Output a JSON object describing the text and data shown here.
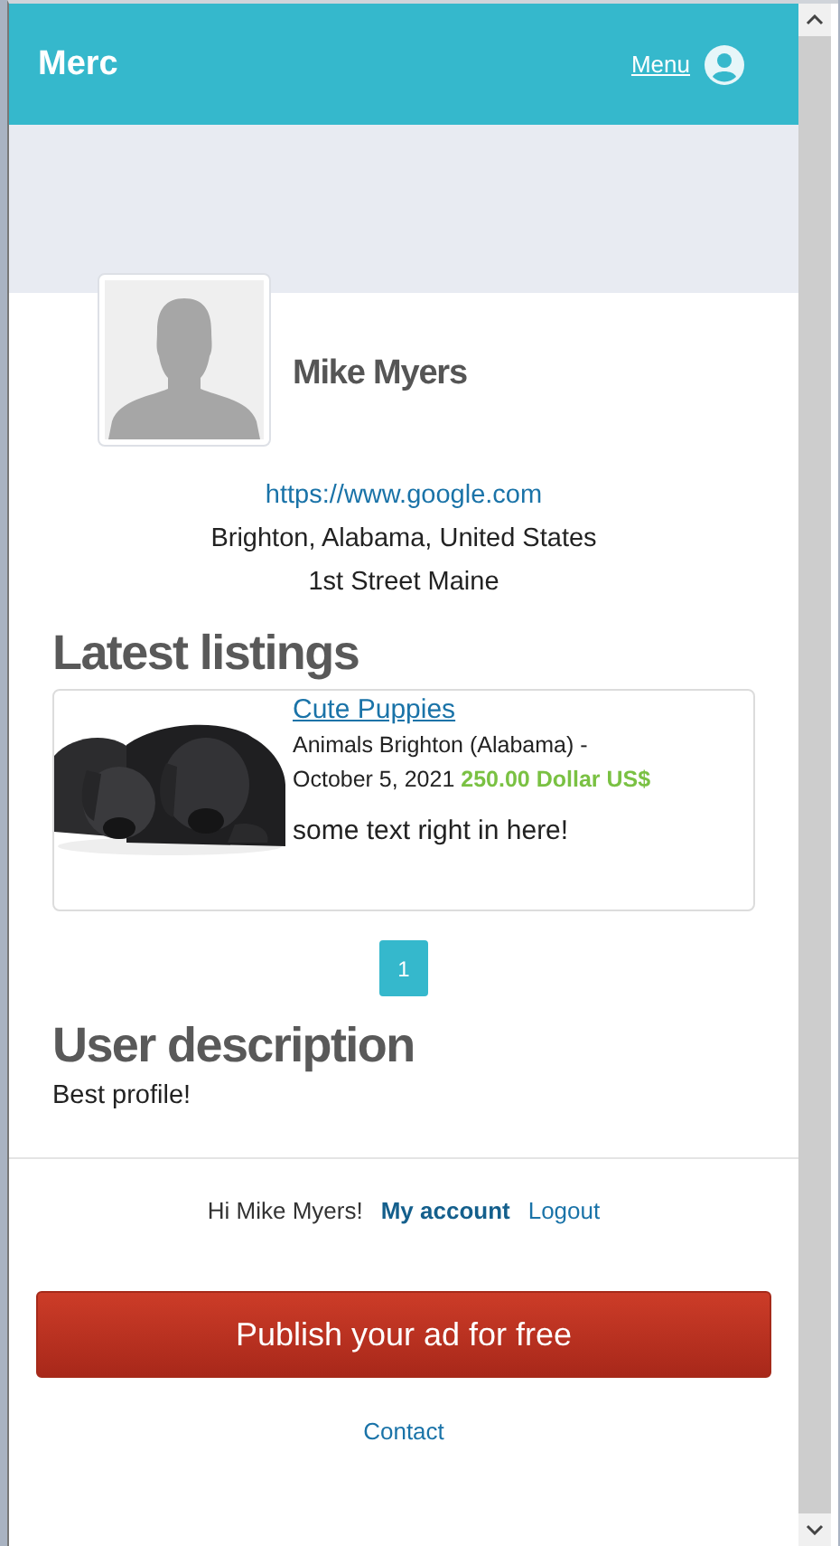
{
  "header": {
    "brand": "Merc",
    "menu_label": "Menu"
  },
  "profile": {
    "name": "Mike Myers",
    "website": "https://www.google.com",
    "location": "Brighton, Alabama, United States",
    "address": "1st Street Maine"
  },
  "listings_section": {
    "heading": "Latest listings",
    "listings": [
      {
        "title": "Cute Puppies",
        "meta": "Animals Brighton (Alabama) - October 5, 2021",
        "price": "250.00 Dollar US$",
        "description": "some text right in here!"
      }
    ],
    "pages": [
      {
        "label": "1",
        "selected": true
      }
    ]
  },
  "description_section": {
    "heading": "User description",
    "text": "Best profile!"
  },
  "footer": {
    "greeting": "Hi Mike Myers!",
    "links": [
      {
        "label": "My account",
        "kind": "strong"
      },
      {
        "label": "Logout",
        "kind": "plain"
      }
    ],
    "publish_button": "Publish your ad for free",
    "contact_link": "Contact"
  }
}
